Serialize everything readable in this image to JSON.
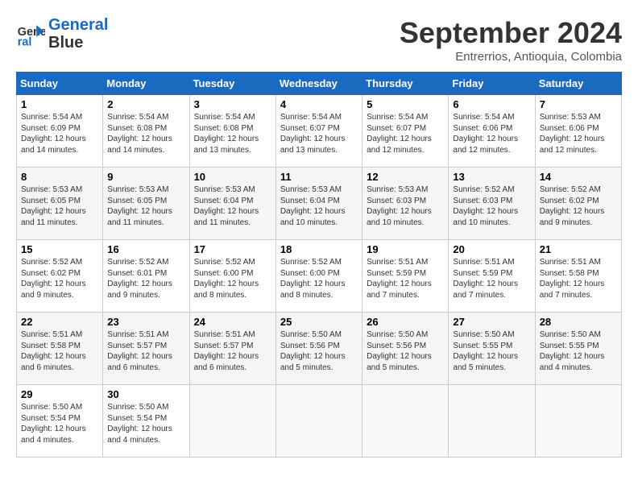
{
  "header": {
    "logo_line1": "General",
    "logo_line2": "Blue",
    "month": "September 2024",
    "location": "Entrerrios, Antioquia, Colombia"
  },
  "weekdays": [
    "Sunday",
    "Monday",
    "Tuesday",
    "Wednesday",
    "Thursday",
    "Friday",
    "Saturday"
  ],
  "weeks": [
    [
      {
        "day": "1",
        "info": "Sunrise: 5:54 AM\nSunset: 6:09 PM\nDaylight: 12 hours\nand 14 minutes."
      },
      {
        "day": "2",
        "info": "Sunrise: 5:54 AM\nSunset: 6:08 PM\nDaylight: 12 hours\nand 14 minutes."
      },
      {
        "day": "3",
        "info": "Sunrise: 5:54 AM\nSunset: 6:08 PM\nDaylight: 12 hours\nand 13 minutes."
      },
      {
        "day": "4",
        "info": "Sunrise: 5:54 AM\nSunset: 6:07 PM\nDaylight: 12 hours\nand 13 minutes."
      },
      {
        "day": "5",
        "info": "Sunrise: 5:54 AM\nSunset: 6:07 PM\nDaylight: 12 hours\nand 12 minutes."
      },
      {
        "day": "6",
        "info": "Sunrise: 5:54 AM\nSunset: 6:06 PM\nDaylight: 12 hours\nand 12 minutes."
      },
      {
        "day": "7",
        "info": "Sunrise: 5:53 AM\nSunset: 6:06 PM\nDaylight: 12 hours\nand 12 minutes."
      }
    ],
    [
      {
        "day": "8",
        "info": "Sunrise: 5:53 AM\nSunset: 6:05 PM\nDaylight: 12 hours\nand 11 minutes."
      },
      {
        "day": "9",
        "info": "Sunrise: 5:53 AM\nSunset: 6:05 PM\nDaylight: 12 hours\nand 11 minutes."
      },
      {
        "day": "10",
        "info": "Sunrise: 5:53 AM\nSunset: 6:04 PM\nDaylight: 12 hours\nand 11 minutes."
      },
      {
        "day": "11",
        "info": "Sunrise: 5:53 AM\nSunset: 6:04 PM\nDaylight: 12 hours\nand 10 minutes."
      },
      {
        "day": "12",
        "info": "Sunrise: 5:53 AM\nSunset: 6:03 PM\nDaylight: 12 hours\nand 10 minutes."
      },
      {
        "day": "13",
        "info": "Sunrise: 5:52 AM\nSunset: 6:03 PM\nDaylight: 12 hours\nand 10 minutes."
      },
      {
        "day": "14",
        "info": "Sunrise: 5:52 AM\nSunset: 6:02 PM\nDaylight: 12 hours\nand 9 minutes."
      }
    ],
    [
      {
        "day": "15",
        "info": "Sunrise: 5:52 AM\nSunset: 6:02 PM\nDaylight: 12 hours\nand 9 minutes."
      },
      {
        "day": "16",
        "info": "Sunrise: 5:52 AM\nSunset: 6:01 PM\nDaylight: 12 hours\nand 9 minutes."
      },
      {
        "day": "17",
        "info": "Sunrise: 5:52 AM\nSunset: 6:00 PM\nDaylight: 12 hours\nand 8 minutes."
      },
      {
        "day": "18",
        "info": "Sunrise: 5:52 AM\nSunset: 6:00 PM\nDaylight: 12 hours\nand 8 minutes."
      },
      {
        "day": "19",
        "info": "Sunrise: 5:51 AM\nSunset: 5:59 PM\nDaylight: 12 hours\nand 7 minutes."
      },
      {
        "day": "20",
        "info": "Sunrise: 5:51 AM\nSunset: 5:59 PM\nDaylight: 12 hours\nand 7 minutes."
      },
      {
        "day": "21",
        "info": "Sunrise: 5:51 AM\nSunset: 5:58 PM\nDaylight: 12 hours\nand 7 minutes."
      }
    ],
    [
      {
        "day": "22",
        "info": "Sunrise: 5:51 AM\nSunset: 5:58 PM\nDaylight: 12 hours\nand 6 minutes."
      },
      {
        "day": "23",
        "info": "Sunrise: 5:51 AM\nSunset: 5:57 PM\nDaylight: 12 hours\nand 6 minutes."
      },
      {
        "day": "24",
        "info": "Sunrise: 5:51 AM\nSunset: 5:57 PM\nDaylight: 12 hours\nand 6 minutes."
      },
      {
        "day": "25",
        "info": "Sunrise: 5:50 AM\nSunset: 5:56 PM\nDaylight: 12 hours\nand 5 minutes."
      },
      {
        "day": "26",
        "info": "Sunrise: 5:50 AM\nSunset: 5:56 PM\nDaylight: 12 hours\nand 5 minutes."
      },
      {
        "day": "27",
        "info": "Sunrise: 5:50 AM\nSunset: 5:55 PM\nDaylight: 12 hours\nand 5 minutes."
      },
      {
        "day": "28",
        "info": "Sunrise: 5:50 AM\nSunset: 5:55 PM\nDaylight: 12 hours\nand 4 minutes."
      }
    ],
    [
      {
        "day": "29",
        "info": "Sunrise: 5:50 AM\nSunset: 5:54 PM\nDaylight: 12 hours\nand 4 minutes."
      },
      {
        "day": "30",
        "info": "Sunrise: 5:50 AM\nSunset: 5:54 PM\nDaylight: 12 hours\nand 4 minutes."
      },
      {
        "day": "",
        "info": ""
      },
      {
        "day": "",
        "info": ""
      },
      {
        "day": "",
        "info": ""
      },
      {
        "day": "",
        "info": ""
      },
      {
        "day": "",
        "info": ""
      }
    ]
  ]
}
